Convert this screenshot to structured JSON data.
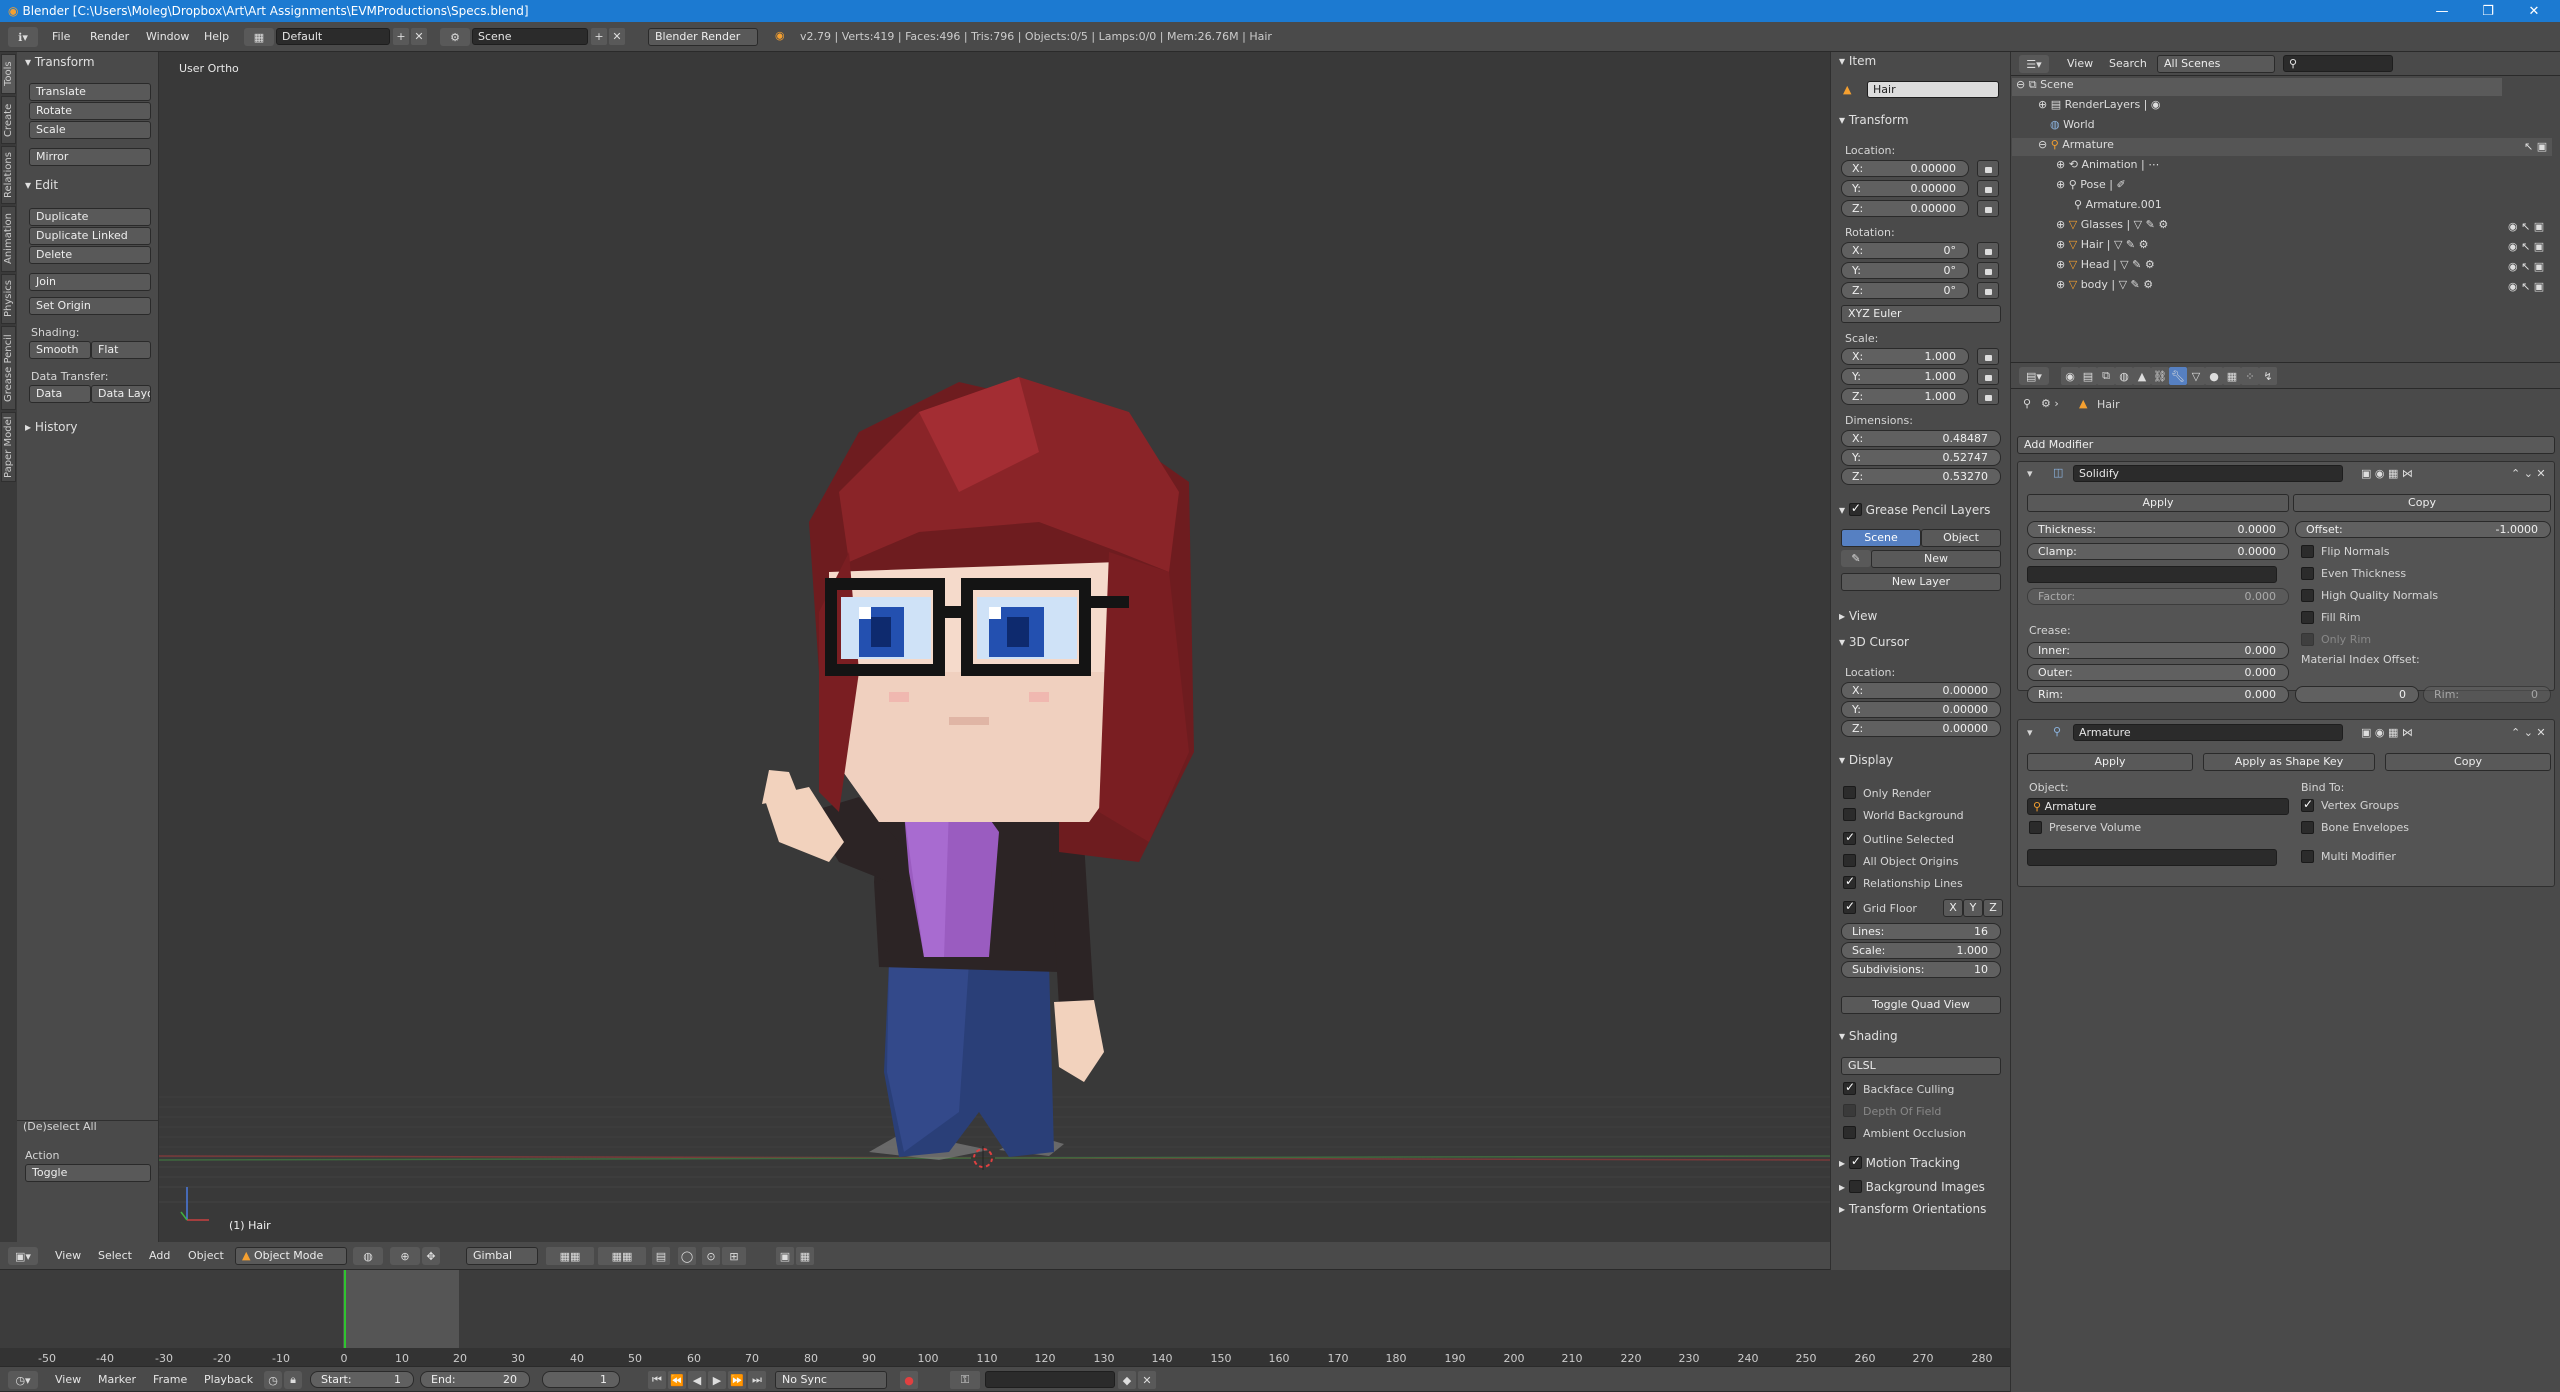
{
  "window": {
    "title": "Blender [C:\\Users\\Moleg\\Dropbox\\Art\\Art Assignments\\EVMProductions\\Specs.blend]"
  },
  "info_header": {
    "menus": [
      "File",
      "Render",
      "Window",
      "Help"
    ],
    "layout": "Default",
    "scene": "Scene",
    "engine": "Blender Render",
    "stats": "v2.79 | Verts:419 | Faces:496 | Tris:796 | Objects:0/5 | Lamps:0/0 | Mem:26.76M | Hair"
  },
  "tool_tabs": [
    "Tools",
    "Create",
    "Relations",
    "Animation",
    "Physics",
    "Grease Pencil",
    "Paper Model"
  ],
  "toolshelf": {
    "transform_title": "Transform",
    "translate": "Translate",
    "rotate": "Rotate",
    "scale": "Scale",
    "mirror": "Mirror",
    "edit_title": "Edit",
    "duplicate": "Duplicate",
    "duplicate_linked": "Duplicate Linked",
    "delete": "Delete",
    "join": "Join",
    "set_origin": "Set Origin",
    "shading_label": "Shading:",
    "smooth": "Smooth",
    "flat": "Flat",
    "data_transfer_label": "Data Transfer:",
    "data": "Data",
    "data_layo": "Data Layo",
    "history": "History",
    "op_title": "(De)select All",
    "action_label": "Action",
    "action_value": "Toggle"
  },
  "viewport": {
    "view_label": "User Ortho",
    "object_label": "(1) Hair"
  },
  "view3d_header": {
    "menus": [
      "View",
      "Select",
      "Add",
      "Object"
    ],
    "mode": "Object Mode",
    "orientation": "Gimbal"
  },
  "properties_n": {
    "item_title": "Item",
    "item_name": "Hair",
    "transform_title": "Transform",
    "location_label": "Location:",
    "location": [
      {
        "axis": "X:",
        "value": "0.00000"
      },
      {
        "axis": "Y:",
        "value": "0.00000"
      },
      {
        "axis": "Z:",
        "value": "0.00000"
      }
    ],
    "rotation_label": "Rotation:",
    "rotation": [
      {
        "axis": "X:",
        "value": "0°"
      },
      {
        "axis": "Y:",
        "value": "0°"
      },
      {
        "axis": "Z:",
        "value": "0°"
      }
    ],
    "rotation_mode": "XYZ Euler",
    "scale_label": "Scale:",
    "scale": [
      {
        "axis": "X:",
        "value": "1.000"
      },
      {
        "axis": "Y:",
        "value": "1.000"
      },
      {
        "axis": "Z:",
        "value": "1.000"
      }
    ],
    "dimensions_label": "Dimensions:",
    "dimensions": [
      {
        "axis": "X:",
        "value": "0.48487"
      },
      {
        "axis": "Y:",
        "value": "0.52747"
      },
      {
        "axis": "Z:",
        "value": "0.53270"
      }
    ],
    "grease_title": "Grease Pencil Layers",
    "scene_tab": "Scene",
    "object_tab": "Object",
    "new": "New",
    "new_layer": "New Layer",
    "view_title": "View",
    "cursor_title": "3D Cursor",
    "cursor_location_label": "Location:",
    "cursor": [
      {
        "axis": "X:",
        "value": "0.00000"
      },
      {
        "axis": "Y:",
        "value": "0.00000"
      },
      {
        "axis": "Z:",
        "value": "0.00000"
      }
    ],
    "display_title": "Display",
    "only_render": "Only Render",
    "world_background": "World Background",
    "outline_selected": "Outline Selected",
    "all_object_origins": "All Object Origins",
    "relationship_lines": "Relationship Lines",
    "grid_floor": "Grid Floor",
    "axis_x": "X",
    "axis_y": "Y",
    "axis_z": "Z",
    "lines": {
      "label": "Lines:",
      "value": "16"
    },
    "grid_scale": {
      "label": "Scale:",
      "value": "1.000"
    },
    "subdivisions": {
      "label": "Subdivisions:",
      "value": "10"
    },
    "toggle_quad": "Toggle Quad View",
    "shading_title": "Shading",
    "shading_mode": "GLSL",
    "backface": "Backface Culling",
    "dof": "Depth Of Field",
    "ao": "Ambient Occlusion",
    "motion_tracking": "Motion Tracking",
    "background_images": "Background Images",
    "transform_orientations": "Transform Orientations"
  },
  "outliner": {
    "view": "View",
    "search": "Search",
    "filter": "All Scenes",
    "rows": [
      "Scene",
      "RenderLayers",
      "World",
      "Armature",
      "Animation",
      "Pose",
      "Armature.001",
      "Glasses",
      "Hair",
      "Head",
      "body"
    ]
  },
  "properties": {
    "breadcrumb": "Hair",
    "add_modifier": "Add Modifier",
    "solidify": {
      "name": "Solidify",
      "apply": "Apply",
      "copy": "Copy",
      "thickness_label": "Thickness:",
      "thickness": "0.0000",
      "offset_label": "Offset:",
      "offset": "-1.0000",
      "clamp_label": "Clamp:",
      "clamp": "0.0000",
      "flip_normals": "Flip Normals",
      "even_thickness": "Even Thickness",
      "hq_normals": "High Quality Normals",
      "fill_rim": "Fill Rim",
      "only_rim": "Only Rim",
      "factor_label": "Factor:",
      "factor": "0.000",
      "crease_label": "Crease:",
      "inner_label": "Inner:",
      "inner": "0.000",
      "outer_label": "Outer:",
      "outer": "0.000",
      "rim_label": "Rim:",
      "rim": "0.000",
      "mat_offset_label": "Material Index Offset:",
      "mat_offset": "0",
      "rim2_label": "Rim:",
      "rim2": "0"
    },
    "armature": {
      "name": "Armature",
      "apply": "Apply",
      "apply_shape": "Apply as Shape Key",
      "copy": "Copy",
      "object_label": "Object:",
      "object": "Armature",
      "bind_label": "Bind To:",
      "vertex_groups": "Vertex Groups",
      "bone_envelopes": "Bone Envelopes",
      "preserve_volume": "Preserve Volume",
      "multi_modifier": "Multi Modifier"
    }
  },
  "timeline": {
    "ticks": [
      "-50",
      "-40",
      "-30",
      "-20",
      "-10",
      "0",
      "10",
      "20",
      "30",
      "40",
      "50",
      "60",
      "70",
      "80",
      "90",
      "100",
      "110",
      "120",
      "130",
      "140",
      "150",
      "160",
      "170",
      "180",
      "190",
      "200",
      "210",
      "220",
      "230",
      "240",
      "250",
      "260",
      "270",
      "280"
    ],
    "menus": [
      "View",
      "Marker",
      "Frame",
      "Playback"
    ],
    "start": "Start:",
    "start_value": "1",
    "end": "End:",
    "end_value": "20",
    "current": "1",
    "sync": "No Sync"
  },
  "colors": {
    "accent": "#5680c2",
    "titlebar": "#1c7ad1",
    "playhead": "#2fc42f"
  }
}
